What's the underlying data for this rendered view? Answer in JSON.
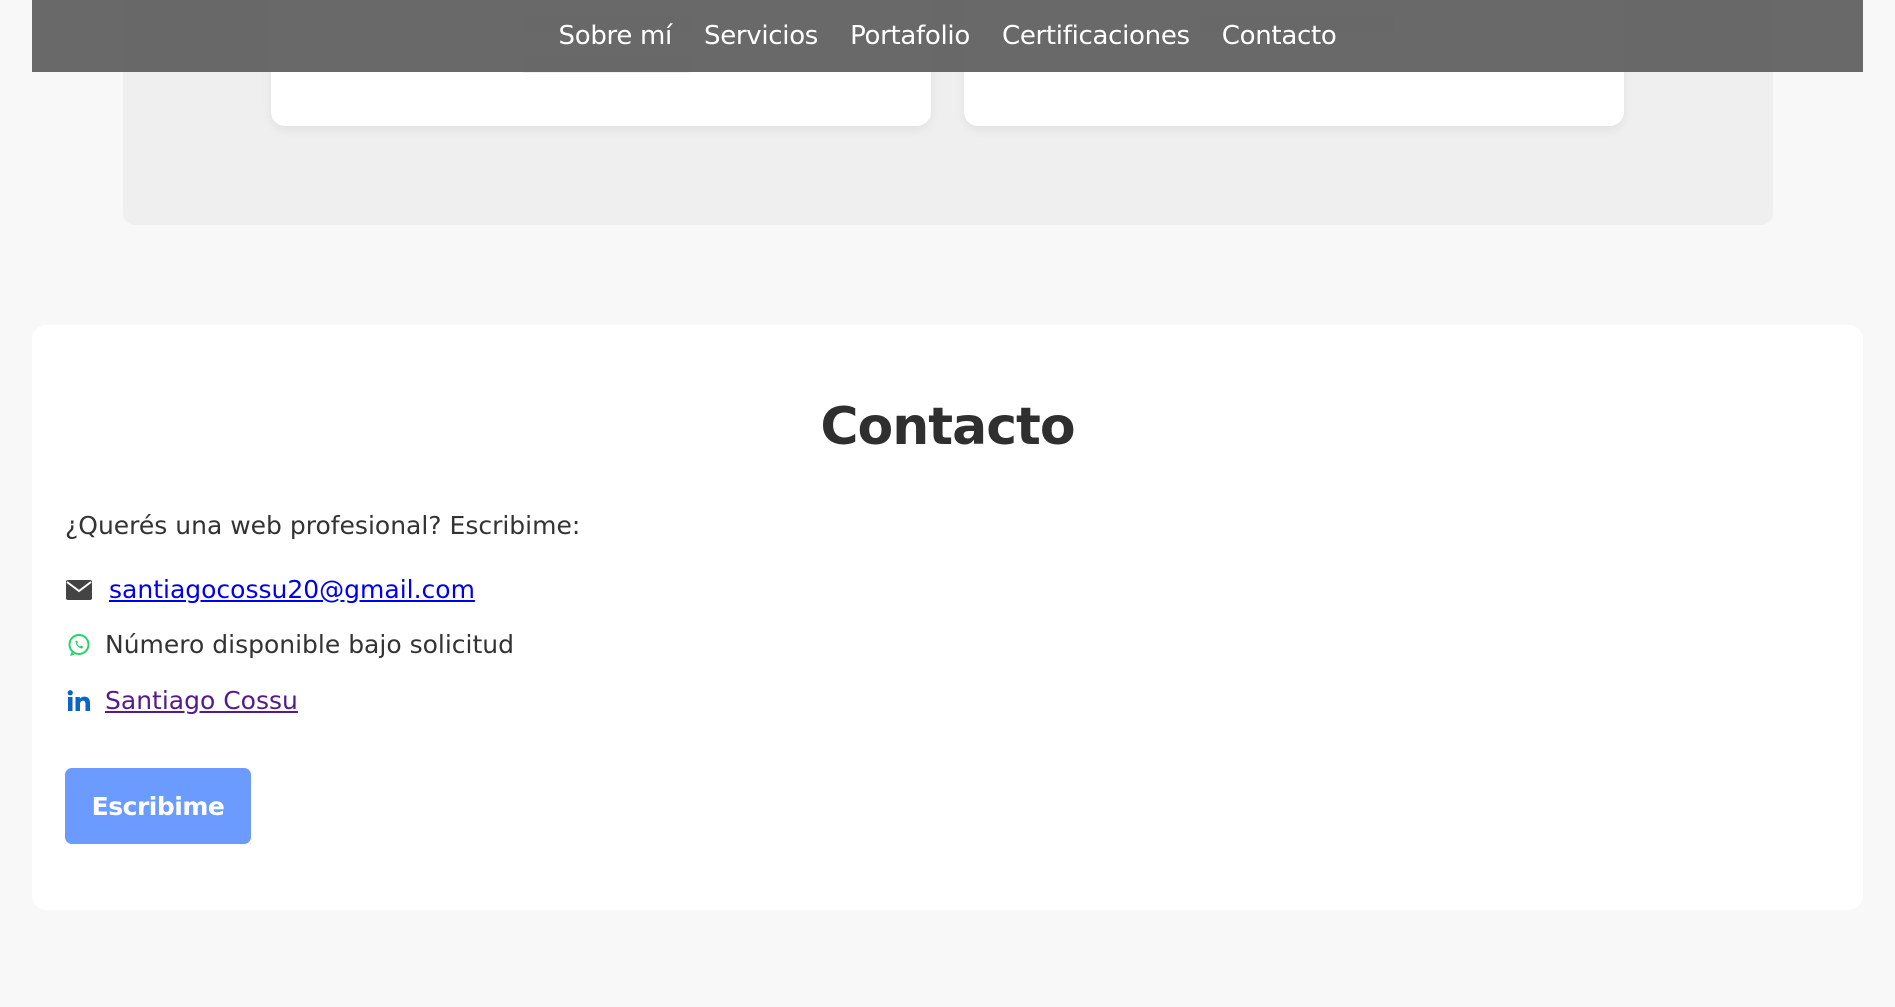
{
  "nav": {
    "items": [
      {
        "label": "Sobre mí"
      },
      {
        "label": "Servicios"
      },
      {
        "label": "Portafolio"
      },
      {
        "label": "Certificaciones"
      },
      {
        "label": "Contacto"
      }
    ]
  },
  "contact": {
    "title": "Contacto",
    "intro": "¿Querés una web profesional? Escribime:",
    "email": "santiagocossu20@gmail.com",
    "phone_text": "Número disponible bajo solicitud",
    "linkedin_text": "Santiago Cossu",
    "button_label": "Escribime"
  },
  "icons": {
    "email": "envelope-icon",
    "phone": "whatsapp-icon",
    "linkedin": "linkedin-icon"
  },
  "colors": {
    "nav_bg": "#5c5c5c",
    "button_bg": "#6b9bff",
    "whatsapp": "#25d366",
    "linkedin": "#0a66c2",
    "link": "#0000ee",
    "visited_link": "#551a8b"
  }
}
